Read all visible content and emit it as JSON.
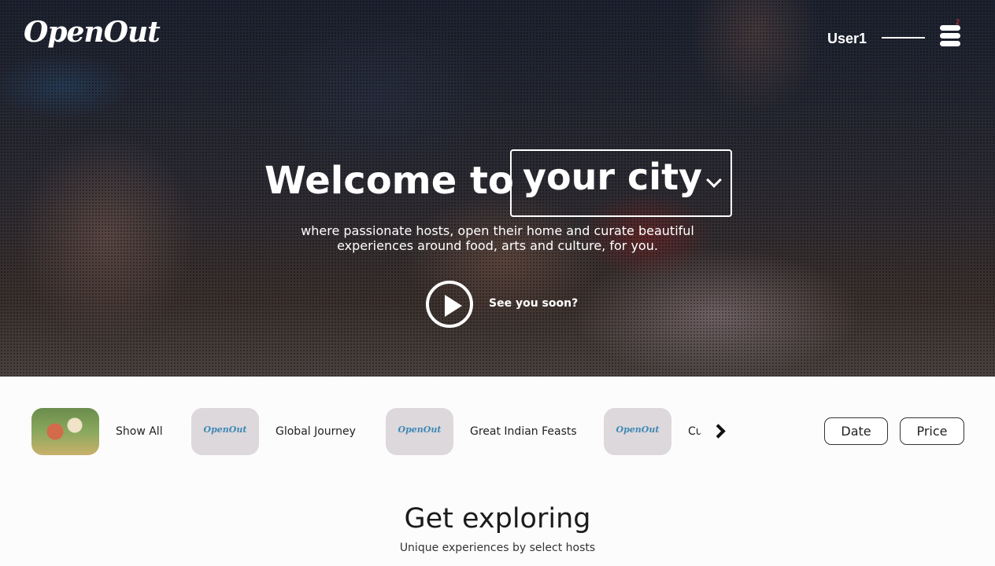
{
  "header": {
    "logo": "OpenOut",
    "user_name": "User1",
    "menu_badge": "2"
  },
  "hero": {
    "welcome_text": "Welcome to",
    "city_value": "your city",
    "subtitle_line1": "where passionate hosts, open their home and curate beautiful",
    "subtitle_line2": "experiences around food, arts and culture, for you.",
    "video_label": "See you soon?"
  },
  "categories": {
    "items": [
      {
        "label": "Show All",
        "thumb": "photo"
      },
      {
        "label": "Global Journey",
        "thumb_logo": "OpenOut"
      },
      {
        "label": "Great Indian Feasts",
        "thumb_logo": "OpenOut"
      },
      {
        "label": "Cu",
        "thumb_logo": "OpenOut"
      }
    ],
    "next_icon": "chevron-right-icon"
  },
  "filters": {
    "date_label": "Date",
    "price_label": "Price"
  },
  "explore": {
    "title": "Get exploring",
    "subtitle": "Unique experiences by select hosts"
  }
}
